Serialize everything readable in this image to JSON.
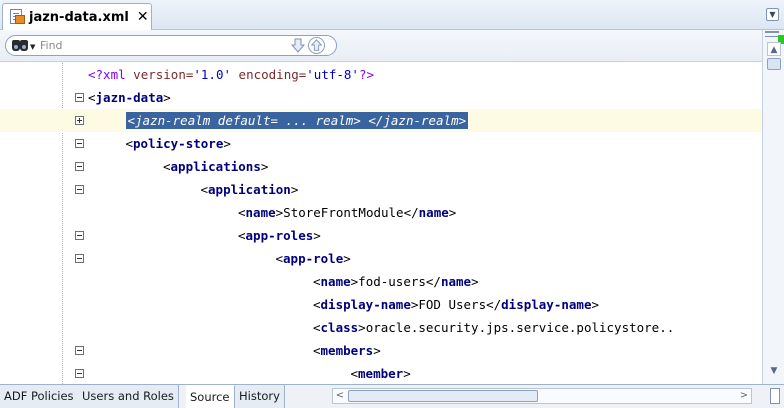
{
  "tab": {
    "title": "jazn-data.xml",
    "close": "✕",
    "icon": "xml-file-icon"
  },
  "find": {
    "placeholder": "Find",
    "value": ""
  },
  "editor": {
    "lines": [
      {
        "indent": 0,
        "fold": "none",
        "parts": [
          [
            "pi",
            "<?xml"
          ],
          [
            "a",
            " version="
          ],
          [
            "v",
            "'1.0'"
          ],
          [
            "a",
            " encoding="
          ],
          [
            "v",
            "'utf-8'"
          ],
          [
            "pi",
            "?>"
          ]
        ]
      },
      {
        "indent": 0,
        "fold": "minus",
        "parts": [
          [
            "p",
            "<"
          ],
          [
            "t",
            "jazn-data"
          ],
          [
            "p",
            ">"
          ]
        ]
      },
      {
        "indent": 1,
        "fold": "plus",
        "selected": true,
        "text": "<jazn-realm default= ... realm> </jazn-realm>"
      },
      {
        "indent": 1,
        "fold": "minus",
        "parts": [
          [
            "p",
            "<"
          ],
          [
            "t",
            "policy-store"
          ],
          [
            "p",
            ">"
          ]
        ]
      },
      {
        "indent": 2,
        "fold": "minus",
        "parts": [
          [
            "p",
            "<"
          ],
          [
            "t",
            "applications"
          ],
          [
            "p",
            ">"
          ]
        ]
      },
      {
        "indent": 3,
        "fold": "minus",
        "parts": [
          [
            "p",
            "<"
          ],
          [
            "t",
            "application"
          ],
          [
            "p",
            ">"
          ]
        ]
      },
      {
        "indent": 4,
        "fold": "none",
        "parts": [
          [
            "p",
            "<"
          ],
          [
            "t",
            "name"
          ],
          [
            "p",
            ">StoreFrontModule</"
          ],
          [
            "t",
            "name"
          ],
          [
            "p",
            ">"
          ]
        ]
      },
      {
        "indent": 4,
        "fold": "minus",
        "parts": [
          [
            "p",
            "<"
          ],
          [
            "t",
            "app-roles"
          ],
          [
            "p",
            ">"
          ]
        ]
      },
      {
        "indent": 5,
        "fold": "minus",
        "parts": [
          [
            "p",
            "<"
          ],
          [
            "t",
            "app-role"
          ],
          [
            "p",
            ">"
          ]
        ]
      },
      {
        "indent": 6,
        "fold": "none",
        "parts": [
          [
            "p",
            "<"
          ],
          [
            "t",
            "name"
          ],
          [
            "p",
            ">fod-users</"
          ],
          [
            "t",
            "name"
          ],
          [
            "p",
            ">"
          ]
        ]
      },
      {
        "indent": 6,
        "fold": "none",
        "parts": [
          [
            "p",
            "<"
          ],
          [
            "t",
            "display-name"
          ],
          [
            "p",
            ">FOD Users</"
          ],
          [
            "t",
            "display-name"
          ],
          [
            "p",
            ">"
          ]
        ]
      },
      {
        "indent": 6,
        "fold": "none",
        "parts": [
          [
            "p",
            "<"
          ],
          [
            "t",
            "class"
          ],
          [
            "p",
            ">oracle.security.jps.service.policystore.."
          ]
        ]
      },
      {
        "indent": 6,
        "fold": "minus",
        "parts": [
          [
            "p",
            "<"
          ],
          [
            "t",
            "members"
          ],
          [
            "p",
            ">"
          ]
        ]
      },
      {
        "indent": 7,
        "fold": "minus",
        "parts": [
          [
            "p",
            "<"
          ],
          [
            "t",
            "member"
          ],
          [
            "p",
            ">"
          ]
        ]
      }
    ]
  },
  "bottom_tabs": [
    {
      "label": "ADF Policies",
      "active": false
    },
    {
      "label": "Users and Roles",
      "active": false
    },
    {
      "label": "Source",
      "active": true
    },
    {
      "label": "History",
      "active": false
    }
  ],
  "icons": {
    "find": "binoculars-icon",
    "next": "arrow-down-icon",
    "previous": "arrow-up-icon",
    "tab_menu": "chevron-down-icon"
  },
  "colors": {
    "selection": "#3a64a0",
    "tag": "#00007f",
    "value": "#0000cc",
    "current_line": "#fdfbe3"
  }
}
